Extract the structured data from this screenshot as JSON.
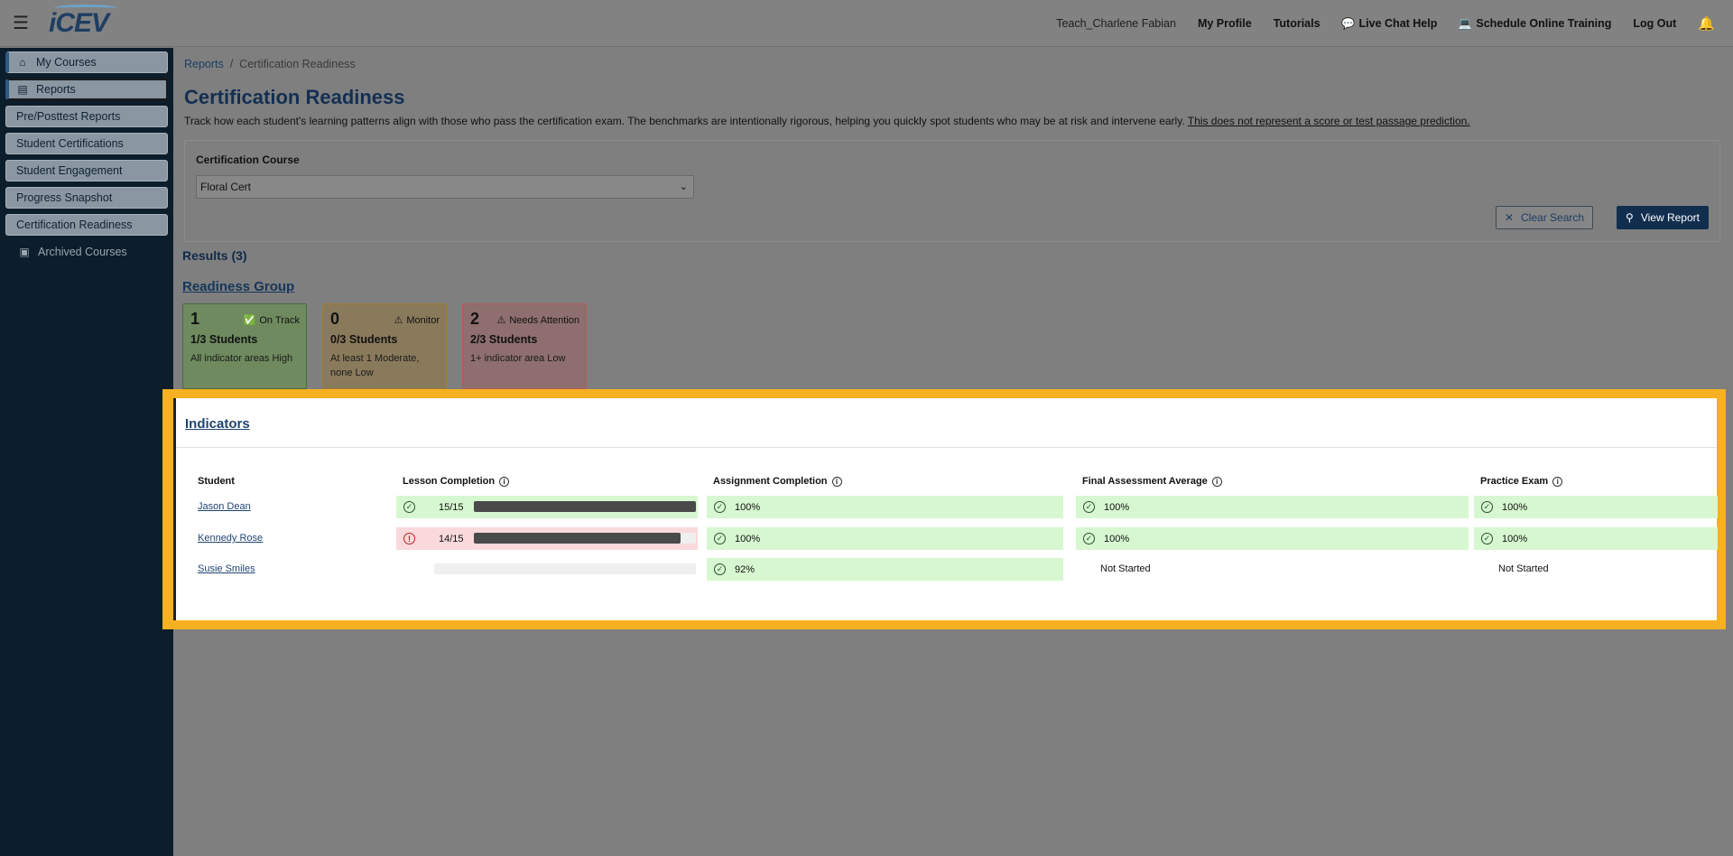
{
  "header": {
    "logo": "iCEV",
    "user": "Teach_Charlene Fabian",
    "links": [
      "My Profile",
      "Tutorials",
      "Live Chat Help",
      "Schedule Online Training",
      "Log Out"
    ]
  },
  "sidebar": {
    "my_courses": "My Courses",
    "reports": "Reports",
    "sub_items": [
      "Pre/Posttest Reports",
      "Student Certifications",
      "Student Engagement",
      "Progress Snapshot",
      "Certification Readiness"
    ],
    "archived": "Archived Courses"
  },
  "breadcrumb": {
    "root": "Reports",
    "sep": "/",
    "current": "Certification Readiness"
  },
  "page": {
    "title": "Certification Readiness",
    "desc": "Track how each student's learning patterns align with those who pass the certification exam. The benchmarks are intentionally rigorous, helping you quickly spot students who may be at risk and intervene early.",
    "disclaimer": "This does not represent a score or test passage prediction."
  },
  "filter": {
    "label": "Certification Course",
    "value": "Floral Cert",
    "clear_label": "Clear Search",
    "view_label": "View Report"
  },
  "results": {
    "label": "Results (3)"
  },
  "readiness": {
    "title": "Readiness Group",
    "cards": [
      {
        "count": "1",
        "status": "On Track",
        "students": "1/3 Students",
        "desc": "All indicator areas High"
      },
      {
        "count": "0",
        "status": "Monitor",
        "students": "0/3 Students",
        "desc": "At least 1 Moderate, none Low"
      },
      {
        "count": "2",
        "status": "Needs Attention",
        "students": "2/3 Students",
        "desc": "1+ indicator area Low"
      }
    ]
  },
  "indicators": {
    "title": "Indicators",
    "headers": [
      "Student",
      "Lesson Completion",
      "Assignment Completion",
      "Final Assessment Average",
      "Practice Exam"
    ],
    "rows": [
      {
        "name": "Jason Dean",
        "lesson": "15/15",
        "lesson_pct": 100,
        "assignment": "100%",
        "final": "100%",
        "practice": "100%"
      },
      {
        "name": "Kennedy Rose",
        "lesson": "14/15",
        "lesson_pct": 93,
        "assignment": "100%",
        "final": "100%",
        "practice": "100%"
      },
      {
        "name": "Susie Smiles",
        "lesson": "",
        "lesson_pct": 0,
        "assignment": "92%",
        "final": "Not Started",
        "practice": "Not Started"
      }
    ]
  },
  "colors": {
    "accent": "#f6b021",
    "nav": "#0c1d2b",
    "primary": "#122e4f"
  }
}
